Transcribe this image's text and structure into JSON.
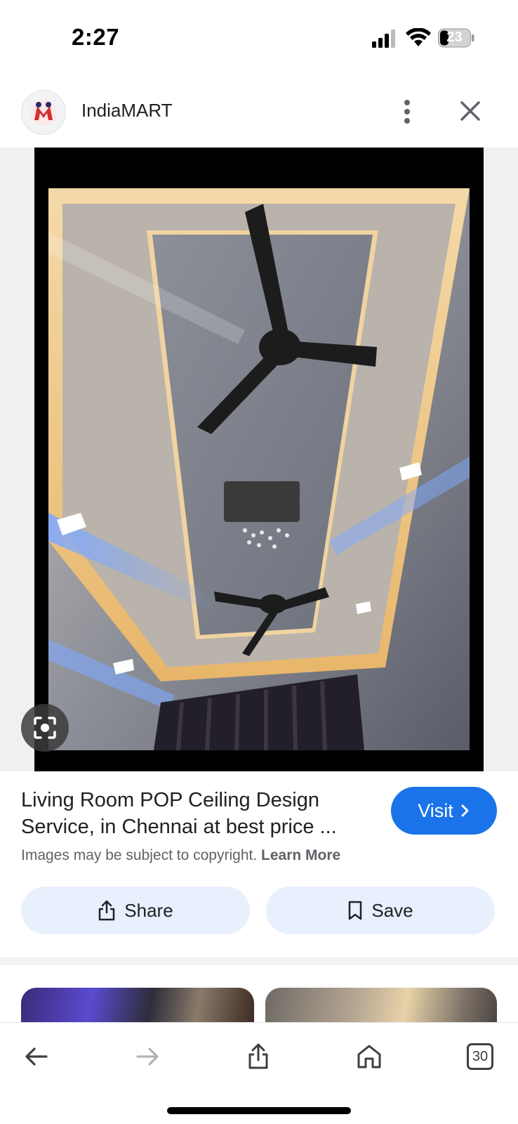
{
  "status_bar": {
    "time": "2:27",
    "battery_level": "23"
  },
  "header": {
    "site_name": "IndiaMART",
    "logo_icon": "indiamart-logo-icon",
    "more_icon": "more-vert-icon",
    "close_icon": "close-icon"
  },
  "image": {
    "lens_icon": "lens-search-icon"
  },
  "result": {
    "title": "Living Room POP Ceiling Design Service, in Chennai at best price ...",
    "visit_label": "Visit",
    "copyright_text": "Images may be subject to copyright.",
    "learn_more_label": "Learn More",
    "share_label": "Share",
    "save_label": "Save"
  },
  "toolbar": {
    "tabs_count": "30"
  },
  "colors": {
    "accent": "#1a73e8",
    "button_bg": "#e8f0fe",
    "image_frame": "#000000"
  }
}
